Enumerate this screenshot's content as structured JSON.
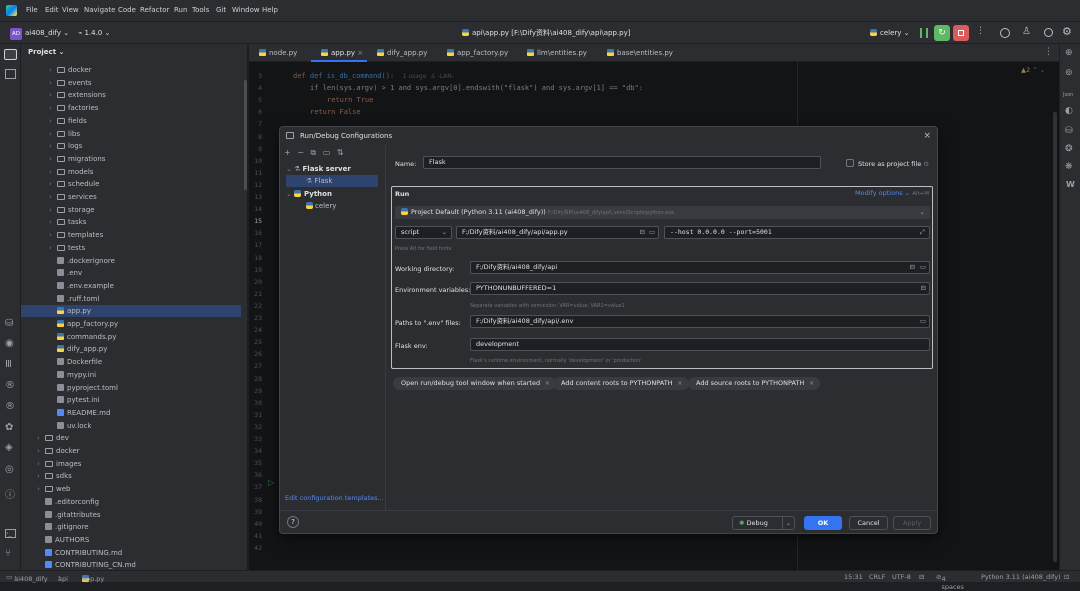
{
  "window": {
    "project_badge": "AD",
    "project_name": "ai408_dify",
    "version": "1.4.0",
    "file_path": "api\\app.py [F:\\Dify资料\\ai408_dify\\api\\app.py]",
    "run_config": "celery",
    "menu": [
      "File",
      "Edit",
      "View",
      "Navigate",
      "Code",
      "Refactor",
      "Run",
      "Tools",
      "Git",
      "Window",
      "Help"
    ]
  },
  "project_panel": {
    "title": "Project",
    "items": [
      {
        "label": "docker",
        "type": "folder",
        "depth": 2
      },
      {
        "label": "events",
        "type": "folder",
        "depth": 2
      },
      {
        "label": "extensions",
        "type": "folder",
        "depth": 2
      },
      {
        "label": "factories",
        "type": "folder",
        "depth": 2
      },
      {
        "label": "fields",
        "type": "folder",
        "depth": 2
      },
      {
        "label": "libs",
        "type": "folder",
        "depth": 2
      },
      {
        "label": "logs",
        "type": "folder",
        "depth": 2
      },
      {
        "label": "migrations",
        "type": "folder",
        "depth": 2
      },
      {
        "label": "models",
        "type": "folder",
        "depth": 2
      },
      {
        "label": "schedule",
        "type": "folder",
        "depth": 2
      },
      {
        "label": "services",
        "type": "folder",
        "depth": 2
      },
      {
        "label": "storage",
        "type": "folder",
        "depth": 2
      },
      {
        "label": "tasks",
        "type": "folder",
        "depth": 2
      },
      {
        "label": "templates",
        "type": "folder",
        "depth": 2
      },
      {
        "label": "tests",
        "type": "folder",
        "depth": 2
      },
      {
        "label": ".dockerignore",
        "type": "file",
        "depth": 2
      },
      {
        "label": ".env",
        "type": "file",
        "depth": 2
      },
      {
        "label": ".env.example",
        "type": "file",
        "depth": 2
      },
      {
        "label": ".ruff.toml",
        "type": "file",
        "depth": 2
      },
      {
        "label": "app.py",
        "type": "py",
        "depth": 2,
        "selected": true
      },
      {
        "label": "app_factory.py",
        "type": "py",
        "depth": 2
      },
      {
        "label": "commands.py",
        "type": "py",
        "depth": 2
      },
      {
        "label": "dify_app.py",
        "type": "py",
        "depth": 2
      },
      {
        "label": "Dockerfile",
        "type": "file",
        "depth": 2
      },
      {
        "label": "mypy.ini",
        "type": "file",
        "depth": 2
      },
      {
        "label": "pyproject.toml",
        "type": "file",
        "depth": 2
      },
      {
        "label": "pytest.ini",
        "type": "file",
        "depth": 2
      },
      {
        "label": "README.md",
        "type": "md",
        "depth": 2
      },
      {
        "label": "uv.lock",
        "type": "file",
        "depth": 2
      },
      {
        "label": "dev",
        "type": "folder",
        "depth": 1
      },
      {
        "label": "docker",
        "type": "folder",
        "depth": 1
      },
      {
        "label": "images",
        "type": "folder",
        "depth": 1
      },
      {
        "label": "sdks",
        "type": "folder",
        "depth": 1
      },
      {
        "label": "web",
        "type": "folder",
        "depth": 1
      },
      {
        "label": ".editorconfig",
        "type": "file",
        "depth": 1
      },
      {
        "label": ".gitattributes",
        "type": "file",
        "depth": 1
      },
      {
        "label": ".gitignore",
        "type": "file",
        "depth": 1
      },
      {
        "label": "AUTHORS",
        "type": "file",
        "depth": 1
      },
      {
        "label": "CONTRIBUTING.md",
        "type": "md",
        "depth": 1
      },
      {
        "label": "CONTRIBUTING_CN.md",
        "type": "md",
        "depth": 1
      }
    ]
  },
  "tabs": [
    "node.py",
    "app.py",
    "dify_app.py",
    "app_factory.py",
    "llm\\entities.py",
    "base\\entities.py"
  ],
  "editor": {
    "lines": [
      "3",
      "4",
      "5",
      "6",
      "7",
      "8",
      "9",
      "10",
      "11",
      "12",
      "13",
      "14",
      "15",
      "16",
      "17",
      "18",
      "19",
      "20",
      "21",
      "22",
      "23",
      "24",
      "25",
      "26",
      "27",
      "28",
      "29",
      "30",
      "31",
      "32",
      "33",
      "34",
      "35",
      "36",
      "37",
      "38",
      "39",
      "40",
      "41",
      "42"
    ],
    "code_def": "def is_db_command():",
    "code_usage": "1 usage  ♙ -LAN-",
    "code_line1": "if len(sys.argv) > 1 and sys.argv[0].endswith(\"flask\") and sys.argv[1] == \"db\":",
    "code_line2": "return True",
    "code_line3": "return False",
    "warnings": "▲2"
  },
  "dialog": {
    "title": "Run/Debug Configurations",
    "tree": {
      "group1": "Flask server",
      "group1_child": "Flask",
      "group2": "Python",
      "group2_child": "celery"
    },
    "edit_templates": "Edit configuration templates...",
    "name_label": "Name:",
    "name_value": "Flask",
    "store_label": "Store as project file",
    "run_section": "Run",
    "modify_options": "Modify options",
    "modify_shortcut": "Alt+M",
    "interpreter": "Project Default (Python 3.11 (ai408_dify))",
    "interpreter_path": "F:\\Dify资料\\ai408_dify\\api\\.venv\\Scripts\\python.exe",
    "script_type": "script",
    "script_path": "F:/Dify资料/ai408_dify/api/app.py",
    "script_params": "--host 0.0.0.0 --port=5001",
    "alt_hint": "Press Alt for field hints",
    "workdir_label": "Working directory:",
    "workdir_value": "F:/Dify资料/ai408_dify/api",
    "env_label": "Environment variables:",
    "env_value": "PYTHONUNBUFFERED=1",
    "env_hint": "Separate variables with semicolon: VAR=value; VAR1=value1",
    "dotenv_label": "Paths to \".env\" files:",
    "dotenv_value": "F:/Dify资料/ai408_dify/api/.env",
    "flaskenv_label": "Flask env:",
    "flaskenv_value": "development",
    "flaskenv_hint": "Flask's runtime environment, normally 'development' or 'production'",
    "chips": [
      "Open run/debug tool window when started",
      "Add content roots to PYTHONPATH",
      "Add source roots to PYTHONPATH"
    ],
    "help": "?",
    "debug_btn": "Debug",
    "ok_btn": "OK",
    "cancel_btn": "Cancel",
    "apply_btn": "Apply"
  },
  "statusbar": {
    "breadcrumb": [
      "ai408_dify",
      "api",
      "app.py"
    ],
    "position": "15:31",
    "line_sep": "CRLF",
    "encoding": "UTF-8",
    "indent": "4 spaces",
    "interpreter": "Python 3.11 (ai408_dify)"
  },
  "colors": {
    "accent": "#3574f0",
    "background": "#1e1f22",
    "panel": "#2b2d30",
    "red_stop": "#db5c5c",
    "green_run": "#5fb865"
  }
}
